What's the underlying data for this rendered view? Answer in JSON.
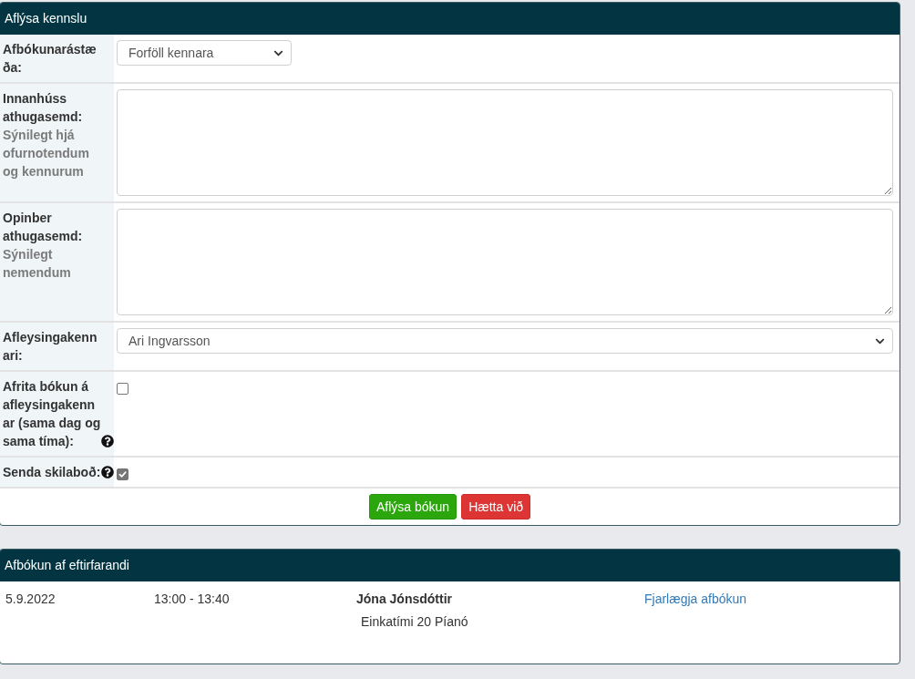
{
  "cancel_panel": {
    "title": "Aflýsa kennslu",
    "fields": [
      {
        "kind": "select",
        "label": "Afbókunarástæða:",
        "value": "Forföll kennara"
      },
      {
        "kind": "textarea",
        "label": "Innanhúss athugasemd:",
        "hint": "Sýnilegt hjá ofurnotendum og kennurum"
      },
      {
        "kind": "textarea",
        "label": "Opinber athugasemd:",
        "hint": "Sýnilegt nemendum"
      },
      {
        "kind": "select",
        "label": "Afleysingakennari:",
        "value": "Ari Ingvarsson"
      },
      {
        "kind": "checkbox",
        "label": "Afrita bókun á afleysingakennar (sama dag og sama tíma):",
        "help": true,
        "checked": false
      },
      {
        "kind": "checkbox",
        "label": "Senda skilaboð:",
        "help": true,
        "checked": true
      }
    ],
    "buttons": [
      {
        "kind": "confirm",
        "label": "Aflýsa bókun"
      },
      {
        "kind": "cancel",
        "label": "Hætta við"
      }
    ]
  },
  "cancellations_panel": {
    "title": "Afbókun af eftirfarandi",
    "rows": [
      {
        "date": "5.9.2022",
        "time": "13:00 - 13:40",
        "student": "Jóna Jónsdóttir",
        "lesson": "Einkatími 20 Píanó",
        "action": "Fjarlægja afbókun"
      }
    ]
  }
}
